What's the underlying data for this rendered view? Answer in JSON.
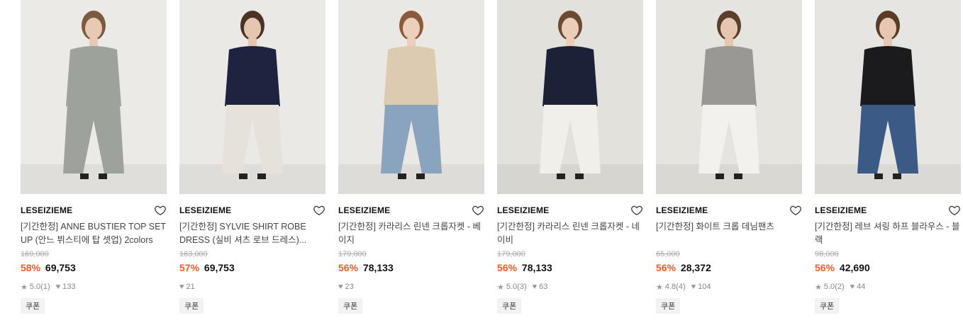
{
  "products": [
    {
      "brand": "LESEIZIEME",
      "title": "[기간한정] ANNE BUSTIER TOP SET UP (안느 뷔스티에 탑 셋업) 2colors",
      "original_price": "169,000",
      "discount": "58%",
      "price": "69,753",
      "rating": "5.0",
      "reviews": "(1)",
      "likes": "133",
      "coupon": "쿠폰",
      "photo_alt": "woman in grey bustier set",
      "palette": {
        "bg": "#eceae6",
        "top": "#9da39a",
        "bottom": "#9da39a",
        "skin": "#e8c9b4",
        "hair": "#7a5a42"
      }
    },
    {
      "brand": "LESEIZIEME",
      "title": "[기간한정] SYLVIE SHIRT ROBE DRESS (실비 셔츠 로브 드레스)...",
      "original_price": "163,000",
      "discount": "57%",
      "price": "69,753",
      "rating": "",
      "reviews": "",
      "likes": "21",
      "coupon": "쿠폰",
      "photo_alt": "woman in navy shirt robe dress",
      "palette": {
        "bg": "#ebe9e5",
        "top": "#1e2440",
        "bottom": "#e6e2da",
        "skin": "#e6c6b0",
        "hair": "#4a3326"
      }
    },
    {
      "brand": "LESEIZIEME",
      "title": "[기간한정] 카라리스 린넨 크롭자켓 - 베이지",
      "original_price": "179,000",
      "discount": "56%",
      "price": "78,133",
      "rating": "",
      "reviews": "",
      "likes": "23",
      "coupon": "쿠폰",
      "photo_alt": "woman in beige linen crop jacket",
      "palette": {
        "bg": "#eae8e4",
        "top": "#dccbb0",
        "bottom": "#8aa3bf",
        "skin": "#ecd0bd",
        "hair": "#8a5a3a"
      }
    },
    {
      "brand": "LESEIZIEME",
      "title": "[기간한정] 카라리스 린넨 크롭자켓 - 네이비",
      "original_price": "179,000",
      "discount": "56%",
      "price": "78,133",
      "rating": "5.0",
      "reviews": "(3)",
      "likes": "63",
      "coupon": "쿠폰",
      "photo_alt": "woman in navy linen crop jacket",
      "palette": {
        "bg": "#e3e1dc",
        "top": "#1b2238",
        "bottom": "#f1efea",
        "skin": "#ebcdb9",
        "hair": "#6b4a33"
      }
    },
    {
      "brand": "LESEIZIEME",
      "title": "[기간한정] 화이트 크롭 데님팬츠",
      "original_price": "65,000",
      "discount": "56%",
      "price": "28,372",
      "rating": "4.8",
      "reviews": "(4)",
      "likes": "104",
      "coupon": "쿠폰",
      "photo_alt": "woman in white cropped denim pants",
      "palette": {
        "bg": "#e6e4df",
        "top": "#9a9895",
        "bottom": "#f2f1ee",
        "skin": "#e6c6b0",
        "hair": "#5a3f2c"
      }
    },
    {
      "brand": "LESEIZIEME",
      "title": "[기간한정] 레브 셔링 하프 블라우스 - 블랙",
      "original_price": "98,000",
      "discount": "56%",
      "price": "42,690",
      "rating": "5.0",
      "reviews": "(2)",
      "likes": "44",
      "coupon": "쿠폰",
      "photo_alt": "woman in black shirring blouse",
      "palette": {
        "bg": "#e7e5e1",
        "top": "#1b1b1d",
        "bottom": "#3b5a86",
        "skin": "#e8c7b2",
        "hair": "#5a3b26"
      }
    }
  ]
}
